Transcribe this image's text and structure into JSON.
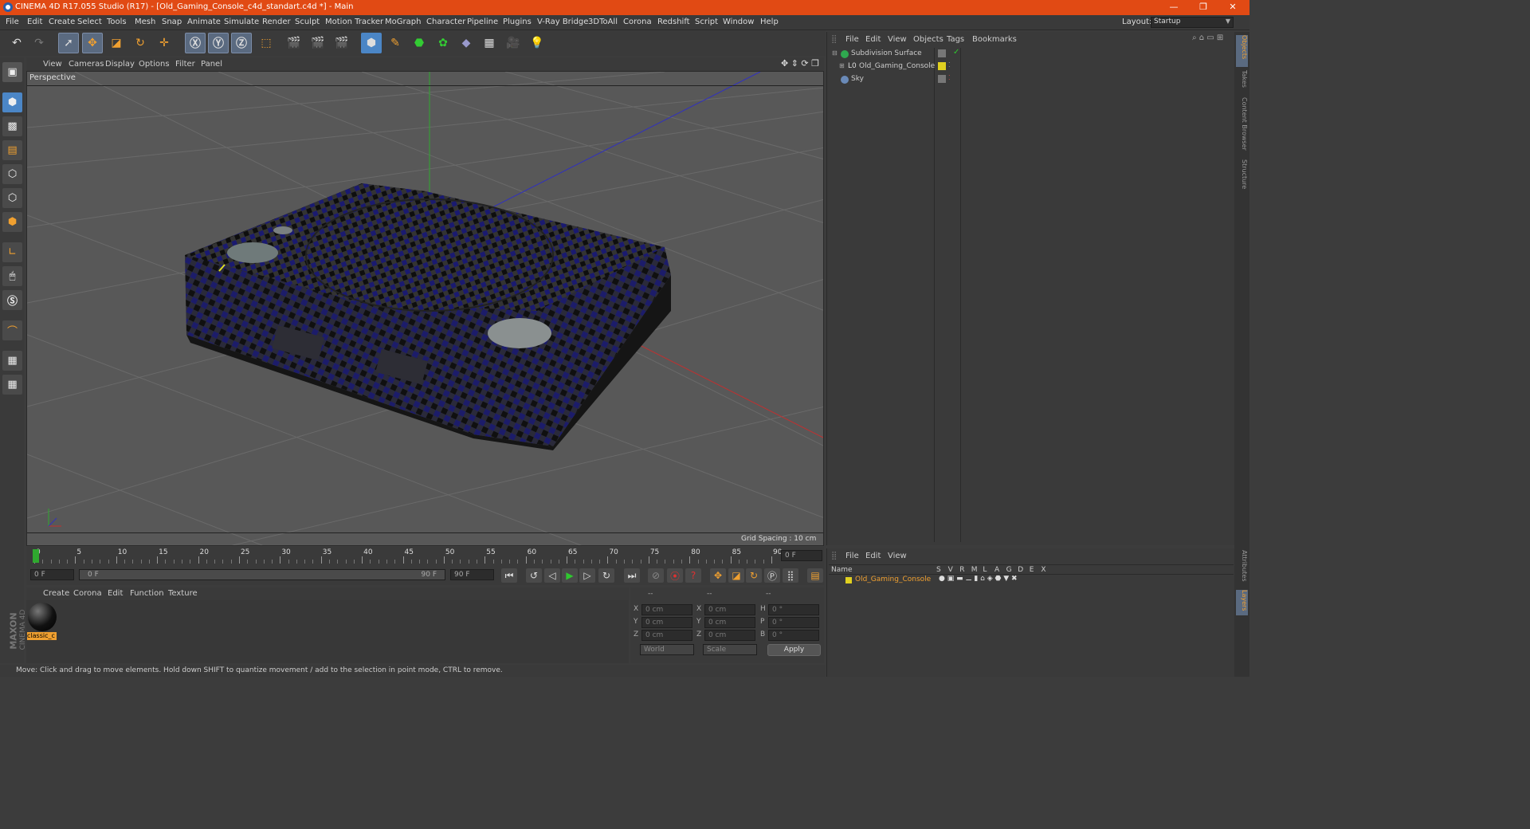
{
  "window": {
    "title": "CINEMA 4D R17.055 Studio (R17) - [Old_Gaming_Console_c4d_standart.c4d *] - Main"
  },
  "menu": [
    "File",
    "Edit",
    "Create",
    "Select",
    "Tools",
    "Mesh",
    "Snap",
    "Animate",
    "Simulate",
    "Render",
    "Sculpt",
    "Motion Tracker",
    "MoGraph",
    "Character",
    "Pipeline",
    "Plugins",
    "V-Ray Bridge",
    "3DToAll",
    "Corona",
    "Redshift",
    "Script",
    "Window",
    "Help"
  ],
  "layout": {
    "label": "Layout:",
    "value": "Startup"
  },
  "viewport": {
    "menu": [
      "View",
      "Cameras",
      "Display",
      "Options",
      "Filter",
      "Panel"
    ],
    "label": "Perspective",
    "grid_spacing": "Grid Spacing : 10 cm"
  },
  "timeline": {
    "ticks": [
      "0",
      "5",
      "10",
      "15",
      "20",
      "25",
      "30",
      "35",
      "40",
      "45",
      "50",
      "55",
      "60",
      "65",
      "70",
      "75",
      "80",
      "85",
      "90"
    ],
    "current_frame": "0 F",
    "start": "0 F",
    "range_start": "0 F",
    "range_end": "90 F",
    "end": "90 F"
  },
  "material_menu": [
    "Create",
    "Corona",
    "Edit",
    "Function",
    "Texture"
  ],
  "material": {
    "name": "classic_c"
  },
  "coords": {
    "headers": [
      "--",
      "--",
      "--"
    ],
    "rows": [
      {
        "a": "X",
        "av": "0 cm",
        "b": "X",
        "bv": "0 cm",
        "c": "H",
        "cv": "0 °"
      },
      {
        "a": "Y",
        "av": "0 cm",
        "b": "Y",
        "bv": "0 cm",
        "c": "P",
        "cv": "0 °"
      },
      {
        "a": "Z",
        "av": "0 cm",
        "b": "Z",
        "bv": "0 cm",
        "c": "B",
        "cv": "0 °"
      }
    ],
    "world": "World",
    "scale": "Scale",
    "apply": "Apply"
  },
  "object_manager": {
    "menu": [
      "File",
      "Edit",
      "View",
      "Objects",
      "Tags",
      "Bookmarks"
    ],
    "objects": [
      "Subdivision Surface",
      "Old_Gaming_Console",
      "Sky"
    ]
  },
  "layer_manager": {
    "menu": [
      "File",
      "Edit",
      "View"
    ],
    "name_header": "Name",
    "columns": [
      "S",
      "V",
      "R",
      "M",
      "L",
      "A",
      "G",
      "D",
      "E",
      "X"
    ],
    "layer": "Old_Gaming_Console"
  },
  "right_tabs": [
    "Objects",
    "Takes",
    "Content Browser",
    "Structure",
    "Attributes",
    "Layers"
  ],
  "status": "Move: Click and drag to move elements. Hold down SHIFT to quantize movement / add to the selection in point mode, CTRL to remove.",
  "branding": {
    "maxon": "MAXON",
    "product": "CINEMA 4D"
  },
  "colors": {
    "titlebar": "#e14a14",
    "accent": "#f0a030",
    "viewport": "#585858"
  }
}
